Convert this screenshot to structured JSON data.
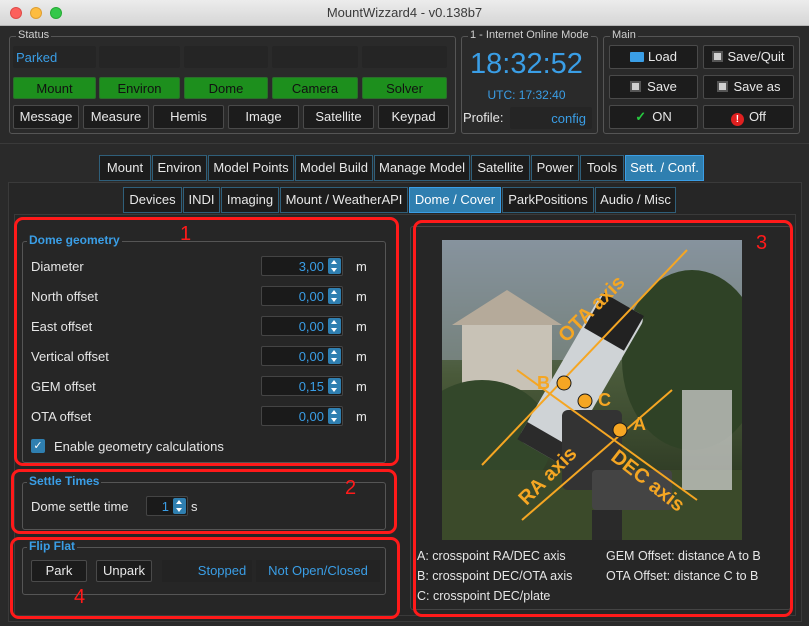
{
  "window": {
    "title": "MountWizzard4 - v0.138b7"
  },
  "status": {
    "group_title": "Status",
    "parked_text": "Parked",
    "indicators": [
      "Mount",
      "Environ",
      "Dome",
      "Camera",
      "Solver"
    ],
    "buttons": [
      "Message",
      "Measure",
      "Hemis",
      "Image",
      "Satellite",
      "Keypad"
    ]
  },
  "online": {
    "group_title": "1 - Internet Online Mode",
    "time": "18:32:52",
    "utc": "UTC: 17:32:40",
    "profile_label": "Profile:",
    "profile_value": "config"
  },
  "main": {
    "group_title": "Main",
    "load": "Load",
    "save_quit": "Save/Quit",
    "save": "Save",
    "save_as": "Save as",
    "on": "ON",
    "off": "Off"
  },
  "tabs": {
    "main": [
      "Mount",
      "Environ",
      "Model Points",
      "Model Build",
      "Manage Model",
      "Satellite",
      "Power",
      "Tools",
      "Sett. / Conf."
    ],
    "sub": [
      "Devices",
      "INDI",
      "Imaging",
      "Mount / WeatherAPI",
      "Dome / Cover",
      "ParkPositions",
      "Audio / Misc"
    ]
  },
  "dome_geometry": {
    "title": "Dome geometry",
    "rows": [
      {
        "label": "Diameter",
        "value": "3,00",
        "unit": "m"
      },
      {
        "label": "North offset",
        "value": "0,00",
        "unit": "m"
      },
      {
        "label": "East offset",
        "value": "0,00",
        "unit": "m"
      },
      {
        "label": "Vertical offset",
        "value": "0,00",
        "unit": "m"
      },
      {
        "label": "GEM offset",
        "value": "0,15",
        "unit": "m"
      },
      {
        "label": "OTA offset",
        "value": "0,00",
        "unit": "m"
      }
    ],
    "enable_label": "Enable geometry calculations"
  },
  "settle": {
    "title": "Settle Times",
    "label": "Dome settle time",
    "value": "1",
    "unit": "s"
  },
  "flip_flat": {
    "title": "Flip Flat",
    "park": "Park",
    "unpark": "Unpark",
    "status1": "Stopped",
    "status2": "Not Open/Closed"
  },
  "annotations": {
    "n1": "1",
    "n2": "2",
    "n3": "3",
    "n4": "4"
  },
  "image": {
    "labels": {
      "ota_axis": "OTA axis",
      "ra_axis": "RA axis",
      "dec_axis": "DEC axis",
      "a": "A",
      "b": "B",
      "c": "C"
    }
  },
  "legend": {
    "a": "A: crosspoint RA/DEC axis",
    "b": "B: crosspoint DEC/OTA axis",
    "c": "C: crosspoint DEC/plate",
    "gem": "GEM Offset: distance A to B",
    "ota": "OTA Offset: distance C to B"
  },
  "colors": {
    "accent": "#3a9ee6",
    "green": "#1d8f1d",
    "red_annotation": "#ff1a1a",
    "orange_label": "#f5a623"
  }
}
